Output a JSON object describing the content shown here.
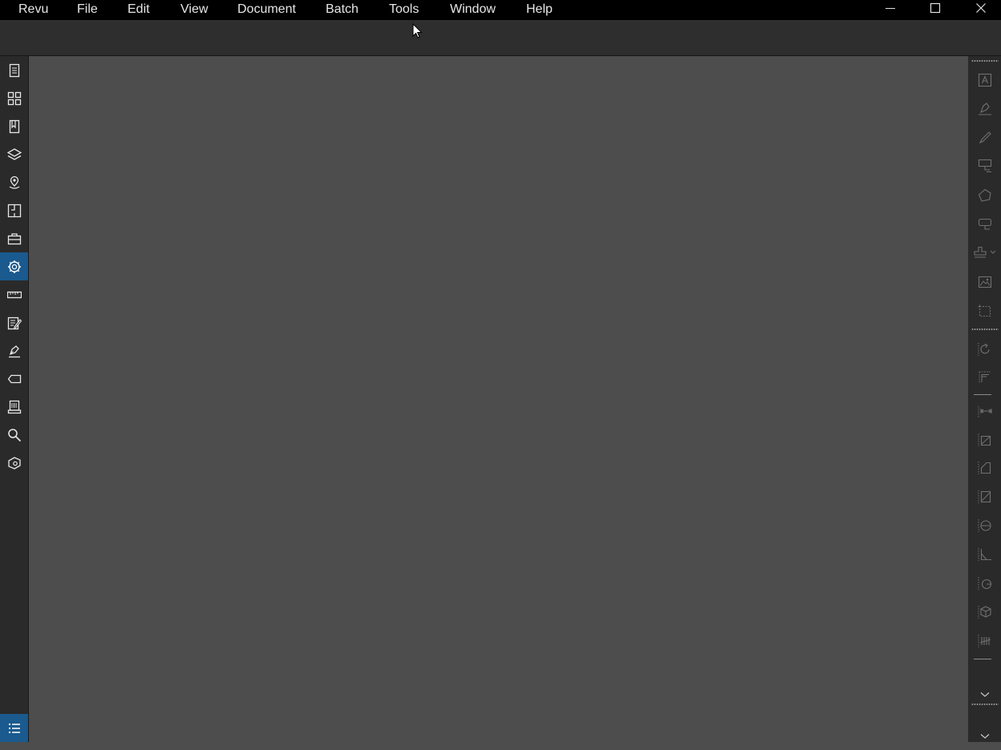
{
  "menubar": {
    "items": [
      "Revu",
      "File",
      "Edit",
      "View",
      "Document",
      "Batch",
      "Tools",
      "Window",
      "Help"
    ]
  },
  "window_controls": {
    "minimize_icon": "minimize-icon",
    "maximize_icon": "maximize-icon",
    "close_icon": "close-icon"
  },
  "left_panel": {
    "tabs": [
      {
        "icon": "thumbnails-icon",
        "active": false
      },
      {
        "icon": "tiles-icon",
        "active": false
      },
      {
        "icon": "bookmarks-icon",
        "active": false
      },
      {
        "icon": "layers-icon",
        "active": false
      },
      {
        "icon": "places-icon",
        "active": false
      },
      {
        "icon": "spaces-icon",
        "active": false
      },
      {
        "icon": "toolchest-icon",
        "active": false
      },
      {
        "icon": "properties-icon",
        "active": true
      },
      {
        "icon": "measurements-icon",
        "active": false
      },
      {
        "icon": "forms-icon",
        "active": false
      },
      {
        "icon": "signatures-icon",
        "active": false
      },
      {
        "icon": "links-icon",
        "active": false
      },
      {
        "icon": "file-access-icon",
        "active": false
      },
      {
        "icon": "search-icon",
        "active": false
      },
      {
        "icon": "studio-icon",
        "active": false
      }
    ],
    "bottom_tab": {
      "icon": "markups-list-icon",
      "active": true
    }
  },
  "right_panel": {
    "markup_tools": [
      "text-box-icon",
      "pen-icon",
      "highlighter-icon",
      "callout-icon",
      "polygon-icon",
      "cloud-icon",
      "stamp-icon",
      "image-icon",
      "snapshot-icon"
    ],
    "measure_tools": [
      "rotate-icon",
      "align-icon",
      "length-icon",
      "polylength-icon",
      "area-icon",
      "perimeter-icon",
      "diameter-icon",
      "angle-icon",
      "radius-icon",
      "volume-icon",
      "count-icon"
    ],
    "expand_icons": [
      "chevron-down-icon",
      "chevron-down-icon"
    ]
  },
  "colors": {
    "menubar_bg": "#000000",
    "toolbar_bg": "#2e2e2e",
    "panel_bg": "#2a2a2a",
    "canvas_bg": "#4d4d4d",
    "accent": "#1a5a8e"
  }
}
